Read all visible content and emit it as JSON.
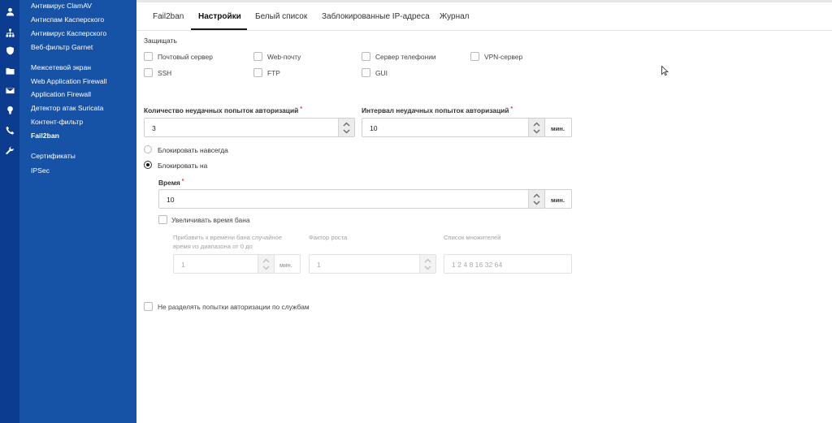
{
  "rail_icons": [
    "user-icon",
    "network-icon",
    "shield-icon",
    "folder-icon",
    "mail-icon",
    "bulb-icon",
    "phone-icon",
    "wrench-icon"
  ],
  "nav": {
    "items": [
      {
        "label": "Антивирус ClamAV"
      },
      {
        "label": "Антиспам Касперского"
      },
      {
        "label": "Антивирус Касперского"
      },
      {
        "label": "Веб-фильтр Garnet"
      },
      {
        "label": "Межсетевой экран"
      },
      {
        "label": "Web Application Firewall"
      },
      {
        "label": "Application Firewall"
      },
      {
        "label": "Детектор атак Suricata"
      },
      {
        "label": "Контент-фильтр"
      },
      {
        "label": "Fail2ban"
      },
      {
        "label": "Сертификаты"
      },
      {
        "label": "IPSec"
      }
    ],
    "active": "Fail2ban"
  },
  "tabs": [
    {
      "label": "Fail2ban"
    },
    {
      "label": "Настройки"
    },
    {
      "label": "Белый список"
    },
    {
      "label": "Заблокированные IP-адреса"
    },
    {
      "label": "Журнал"
    }
  ],
  "active_tab": "Настройки",
  "protect": {
    "label": "Защищать",
    "options": [
      {
        "label": "Почтовый сервер",
        "checked": false
      },
      {
        "label": "Web-почту",
        "checked": false
      },
      {
        "label": "Сервер телефонии",
        "checked": false
      },
      {
        "label": "VPN-сервер",
        "checked": false
      },
      {
        "label": "SSH",
        "checked": false
      },
      {
        "label": "FTP",
        "checked": false
      },
      {
        "label": "GUI",
        "checked": false
      }
    ]
  },
  "auth": {
    "attempts_label": "Количество неудачных попыток авторизаций",
    "attempts_value": "3",
    "interval_label": "Интервал неудачных попыток авторизаций",
    "interval_value": "10",
    "interval_unit": "мин.",
    "required_mark": "*"
  },
  "block": {
    "forever_label": "Блокировать навсегда",
    "for_label": "Блокировать на",
    "selected": "for",
    "time_label": "Время",
    "time_value": "10",
    "time_unit": "мин.",
    "increase_label": "Увеличивать время бана",
    "increase_checked": false,
    "random_label": "Прибавить к времени бана случайное время из диапазона от 0 до",
    "random_value": "1",
    "random_unit": "мин.",
    "factor_label": "Фактор роста",
    "factor_value": "1",
    "multipliers_label": "Список множителей",
    "multipliers_value": "1 2 4 8 16 32 64"
  },
  "no_split": {
    "label": "Не разделять попытки авторизации по службам",
    "checked": false
  }
}
